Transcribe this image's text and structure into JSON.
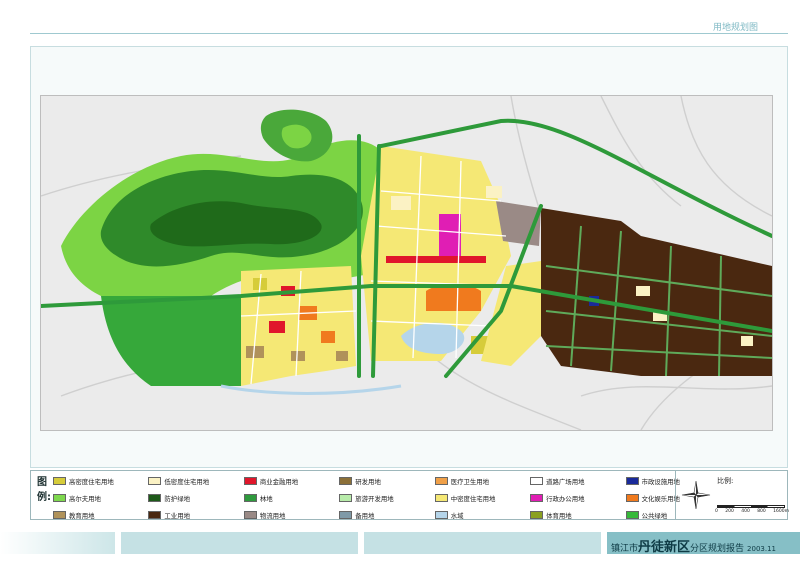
{
  "page": {
    "title": "用地规划图",
    "report_prefix": "镇江市",
    "report_emph": "丹徒新区",
    "report_suffix": "分区规划报告",
    "report_date": "2003.11"
  },
  "legend": {
    "title": "图例:",
    "items": [
      {
        "label": "高密度住宅用地",
        "color": "#d6cc3a"
      },
      {
        "label": "低密度住宅用地",
        "color": "#fbf2c4"
      },
      {
        "label": "商业金融用地",
        "color": "#e0162b"
      },
      {
        "label": "研发用地",
        "color": "#8c7038"
      },
      {
        "label": "医疗卫生用地",
        "color": "#f0a048"
      },
      {
        "label": "道路广场用地",
        "color": "#ffffff"
      },
      {
        "label": "市政设施用地",
        "color": "#1a2a9a"
      },
      {
        "label": "高尔夫用地",
        "color": "#7ed84e"
      },
      {
        "label": "防护绿地",
        "color": "#1e5a1a"
      },
      {
        "label": "林地",
        "color": "#2f9a3d"
      },
      {
        "label": "旅游开发用地",
        "color": "#b8ecaa"
      },
      {
        "label": "中密度住宅用地",
        "color": "#f5e875"
      },
      {
        "label": "行政办公用地",
        "color": "#e01eb4"
      },
      {
        "label": "文化娱乐用地",
        "color": "#f07a1e"
      },
      {
        "label": "教育用地",
        "color": "#b0925a"
      },
      {
        "label": "工业用地",
        "color": "#4a2810"
      },
      {
        "label": "物流用地",
        "color": "#9a8a86"
      },
      {
        "label": "备用地",
        "color": "#7f9aa8"
      },
      {
        "label": "水域",
        "color": "#b5d5ea"
      },
      {
        "label": "体育用地",
        "color": "#8aa020"
      },
      {
        "label": "公共绿地",
        "color": "#36b83a"
      }
    ]
  },
  "scale": {
    "label": "比例:",
    "ticks": [
      "0",
      "200",
      "400",
      "800",
      "1600m"
    ]
  },
  "map": {
    "water_color": "#b5d5ea",
    "road_color": "#f5f5f5",
    "arterial_color": "#3aaa3a"
  }
}
